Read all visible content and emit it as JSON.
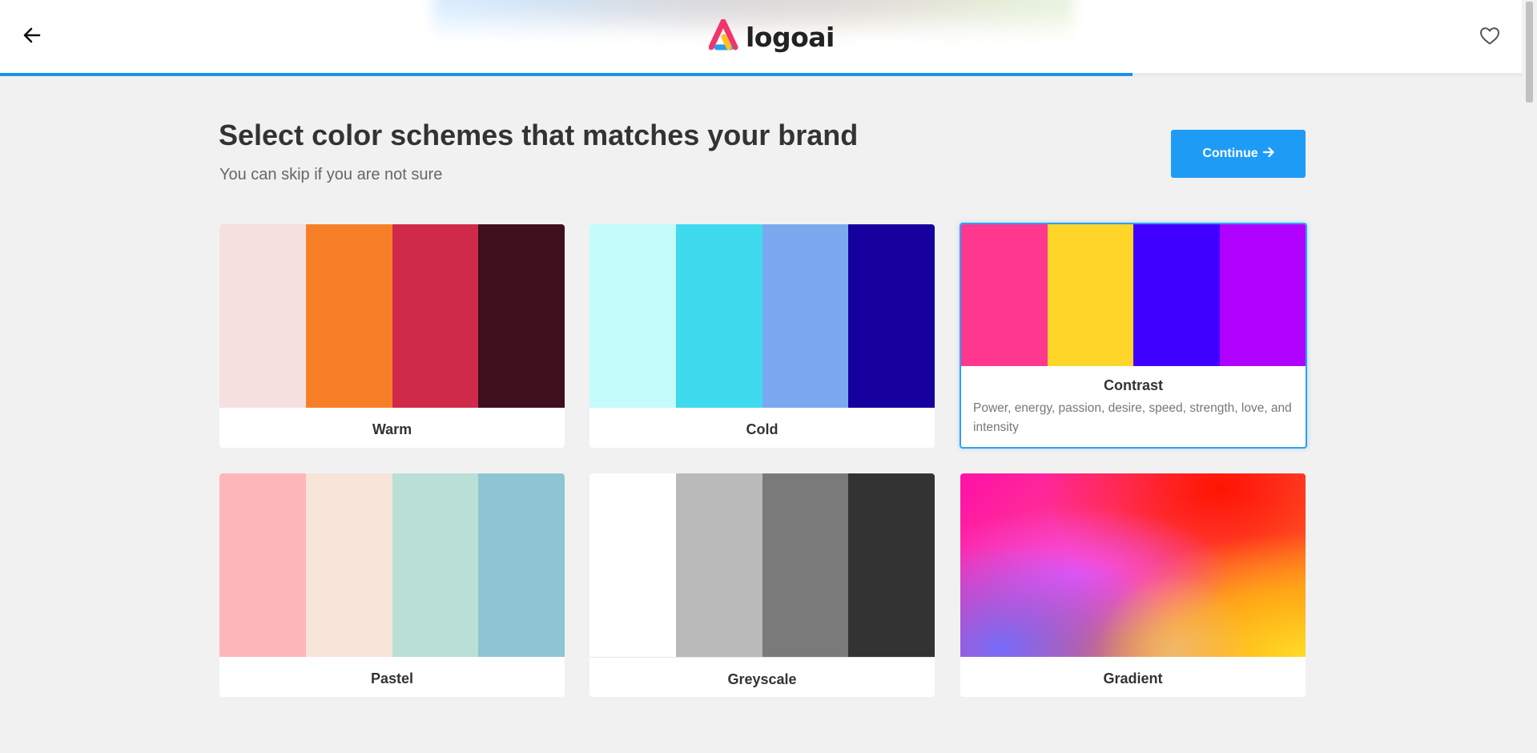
{
  "header": {
    "back_icon": "arrow-left-icon",
    "logo_text": "logoai",
    "favorite_icon": "heart-icon",
    "progress_fraction": 0.744
  },
  "main": {
    "title": "Select color schemes that matches your brand",
    "subtitle": "You can skip if you are not sure",
    "continue_label": "Continue",
    "continue_icon": "arrow-right-icon"
  },
  "schemes": [
    {
      "name": "Warm",
      "colors": [
        "#f5e0df",
        "#f77f27",
        "#d02a4b",
        "#3f0f1e"
      ],
      "selected": false
    },
    {
      "name": "Cold",
      "colors": [
        "#c4fbfb",
        "#3fdaee",
        "#7aa9ef",
        "#16009e"
      ],
      "selected": false
    },
    {
      "name": "Contrast",
      "colors": [
        "#ff378f",
        "#ffd52a",
        "#4000ff",
        "#b000ff"
      ],
      "selected": true,
      "description": "Power, energy, passion, desire, speed, strength, love, and intensity"
    },
    {
      "name": "Pastel",
      "colors": [
        "#fdb7b8",
        "#f8e3d9",
        "#badfd7",
        "#8dc6d2"
      ],
      "selected": false
    },
    {
      "name": "Greyscale",
      "colors": [
        "#ffffff",
        "#bababa",
        "#7a7a7a",
        "#333333"
      ],
      "selected": false
    },
    {
      "name": "Gradient",
      "gradient": true,
      "selected": false
    }
  ],
  "colors": {
    "accent": "#1e9cf5",
    "progress": "#1e8fe6",
    "background": "#f1f1f1"
  }
}
